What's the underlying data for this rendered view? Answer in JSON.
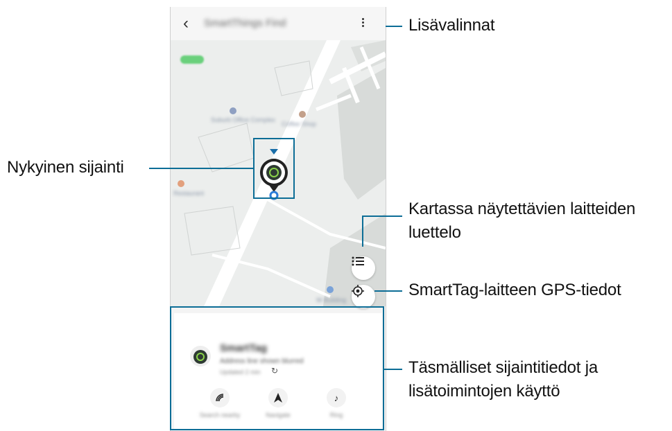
{
  "app": {
    "title": "SmartThings Find",
    "back_glyph": "‹",
    "more_icon": "more-vertical-icon"
  },
  "map": {
    "poi_labels": [
      "Suburb Office Complex",
      "Coffee Shop",
      "Restaurant",
      "W Building"
    ]
  },
  "device_sheet": {
    "name": "SmartTag",
    "address": "Address line shown blurred",
    "updated": "Updated 2 min",
    "actions": [
      {
        "label": "Search nearby",
        "icon": "radar-icon"
      },
      {
        "label": "Navigate",
        "icon": "navigate-arrow-icon"
      },
      {
        "label": "Ring",
        "icon": "music-note-icon"
      }
    ]
  },
  "callouts": {
    "more_options": "Lisävalinnat",
    "current_location": "Nykyinen sijainti",
    "device_list_line1": "Kartassa näytettävien laitteiden",
    "device_list_line2": "luettelo",
    "gps_info": "SmartTag-laitteen GPS-tiedot",
    "details_line1": "Täsmälliset sijaintitiedot ja",
    "details_line2": "lisätoimintojen käyttö"
  },
  "colors": {
    "accent": "#0c6d96",
    "tag_green": "#4caf50"
  }
}
